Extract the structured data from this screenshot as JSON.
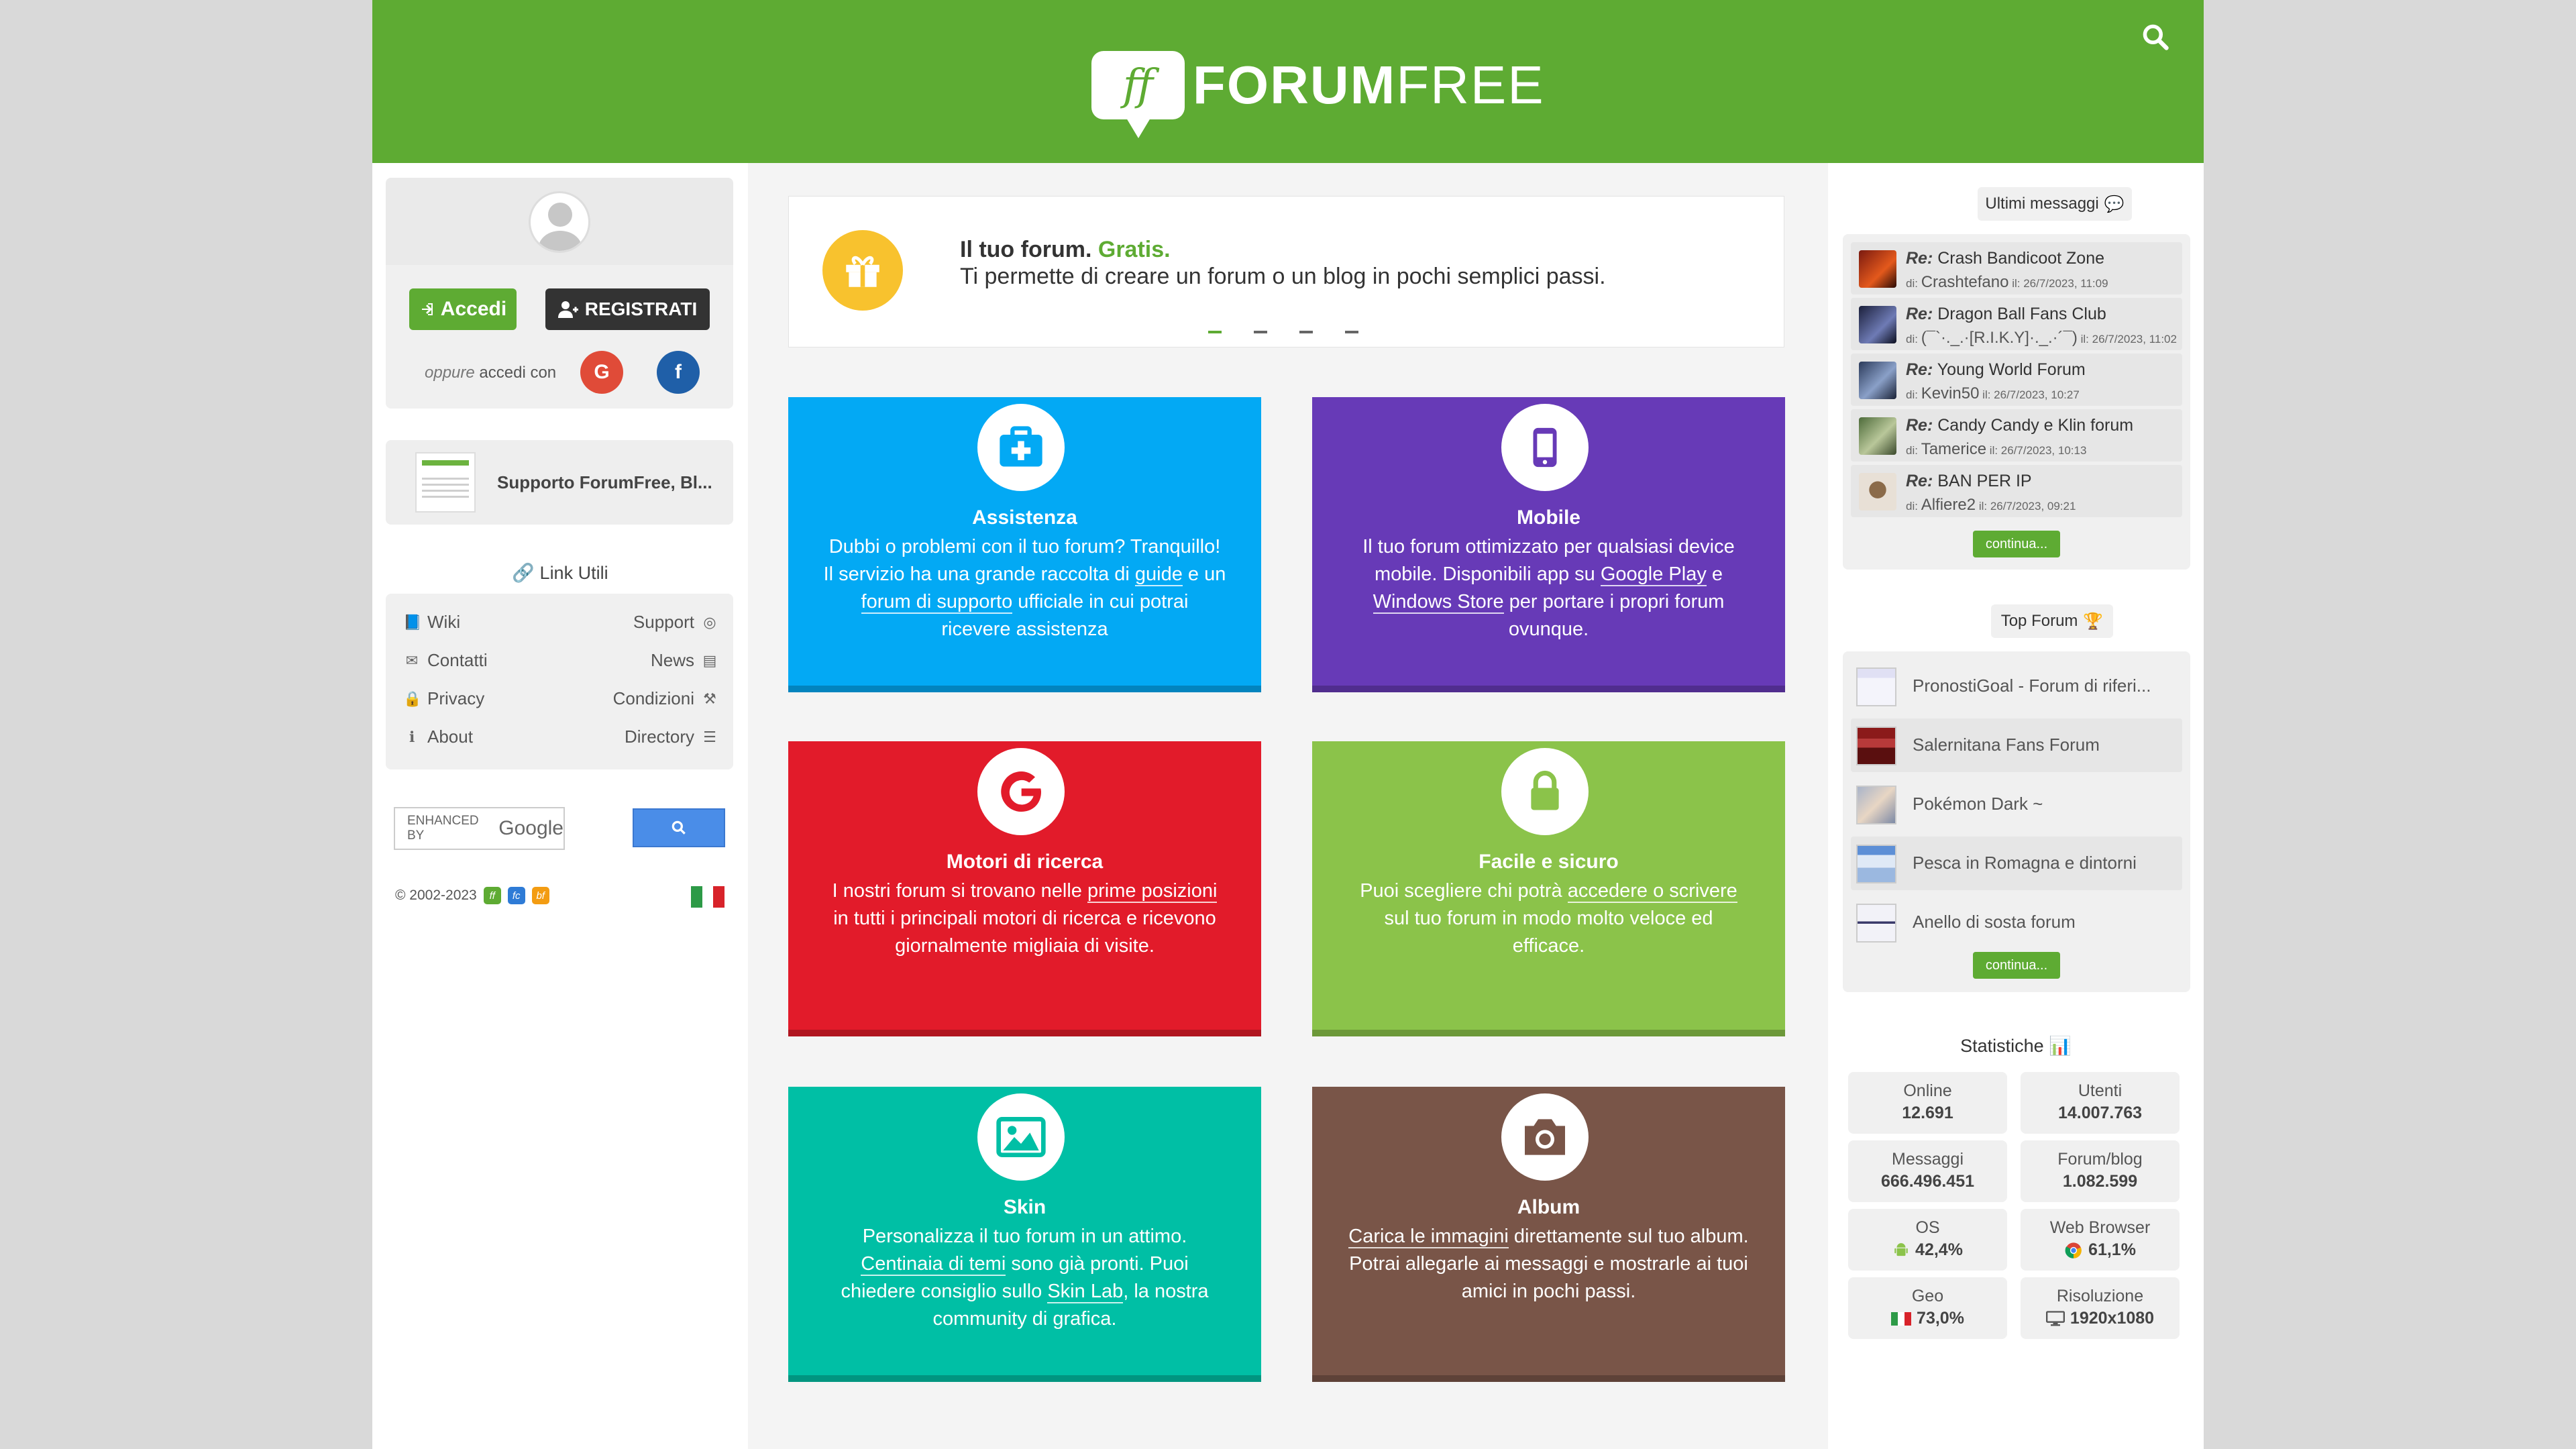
{
  "brand": {
    "mark": "ff",
    "name_bold": "FORUM",
    "name_light": "FREE"
  },
  "login": {
    "accedi": "Accedi",
    "registrati": "REGISTRATI",
    "oppure": "oppure",
    "accedi_con": "accedi con",
    "google": "G",
    "facebook": "f"
  },
  "support": {
    "label": "Supporto ForumFree, Bl..."
  },
  "links": {
    "title": "Link Utili",
    "left": [
      "Wiki",
      "Contatti",
      "Privacy",
      "About"
    ],
    "right": [
      "Support",
      "News",
      "Condizioni",
      "Directory"
    ]
  },
  "search": {
    "enhanced": "ENHANCED BY",
    "google": "Google"
  },
  "footer": {
    "copyright": "© 2002-2023"
  },
  "hero": {
    "line1_a": "Il tuo forum.",
    "line1_b": "Gratis.",
    "line2": "Ti permette di creare un forum o un blog in pochi semplici passi."
  },
  "cards": {
    "assistenza": {
      "title": "Assistenza",
      "t1": "Dubbi o problemi con il tuo forum? Tranquillo!",
      "t2": "Il servizio ha una grande raccolta di",
      "l1": "guide",
      "t3": "e un",
      "l2": "forum di supporto",
      "t4": "ufficiale in cui potrai",
      "t5": "ricevere assistenza"
    },
    "mobile": {
      "title": "Mobile",
      "t1": "Il tuo forum ottimizzato per qualsiasi device",
      "t2": "mobile. Disponibili app su",
      "l1": "Google Play",
      "t3": "e",
      "l2": "Windows Store",
      "t4": "per portare i propri forum",
      "t5": "ovunque."
    },
    "motori": {
      "title": "Motori di ricerca",
      "t1": "I nostri forum si trovano nelle",
      "l1": "prime posizioni",
      "t2": "in tutti i principali motori di ricerca e ricevono",
      "t3": "giornalmente migliaia di visite."
    },
    "facile": {
      "title": "Facile e sicuro",
      "t1": "Puoi scegliere chi potrà",
      "l1": "accedere o scrivere",
      "t2": "sul tuo forum in modo molto veloce ed",
      "t3": "efficace."
    },
    "skin": {
      "title": "Skin",
      "t1": "Personalizza il tuo forum in un attimo.",
      "l1": "Centinaia di temi",
      "t2": "sono già  pronti. Puoi",
      "t3": "chiedere consiglio sullo",
      "l2": "Skin Lab",
      "t4": ", la nostra",
      "t5": "community di grafica."
    },
    "album": {
      "title": "Album",
      "l1": "Carica le immagini",
      "t1": "direttamente sul tuo album.",
      "t2": "Potrai allegarle ai messaggi e mostrarle ai tuoi",
      "t3": "amici in pochi passi."
    }
  },
  "ultimi": {
    "title": "Ultimi messaggi",
    "items": [
      {
        "re": "Re:",
        "topic": "Crash Bandicoot Zone",
        "di": "di:",
        "user": "Crashtefano",
        "il": "il: 26/7/2023, 11:09"
      },
      {
        "re": "Re:",
        "topic": "Dragon Ball Fans Club",
        "di": "di:",
        "user": "(¯`·._.·[R.I.K.Y]·._.·´¯)",
        "il": "il: 26/7/2023, 11:02"
      },
      {
        "re": "Re:",
        "topic": "Young World Forum",
        "di": "di:",
        "user": "Kevin50",
        "il": "il: 26/7/2023, 10:27"
      },
      {
        "re": "Re:",
        "topic": "Candy Candy e Klin forum",
        "di": "di:",
        "user": "Tamerice",
        "il": "il: 26/7/2023, 10:13"
      },
      {
        "re": "Re:",
        "topic": "BAN PER IP",
        "di": "di:",
        "user": "Alfiere2",
        "il": "il: 26/7/2023, 09:21"
      }
    ],
    "more": "continua..."
  },
  "top_forum": {
    "title": "Top Forum",
    "items": [
      "PronostiGoal - Forum di riferi...",
      "Salernitana Fans Forum",
      "Pokémon Dark ~",
      "Pesca in Romagna e dintorni",
      "Anello di sosta forum"
    ],
    "more": "continua..."
  },
  "stats": {
    "title": "Statistiche",
    "online_k": "Online",
    "online_v": "12.691",
    "utenti_k": "Utenti",
    "utenti_v": "14.007.763",
    "messaggi_k": "Messaggi",
    "messaggi_v": "666.496.451",
    "forum_k": "Forum/blog",
    "forum_v": "1.082.599",
    "os_k": "OS",
    "os_v": "42,4%",
    "browser_k": "Web Browser",
    "browser_v": "61,1%",
    "geo_k": "Geo",
    "geo_v": "73,0%",
    "ris_k": "Risoluzione",
    "ris_v": "1920x1080"
  }
}
